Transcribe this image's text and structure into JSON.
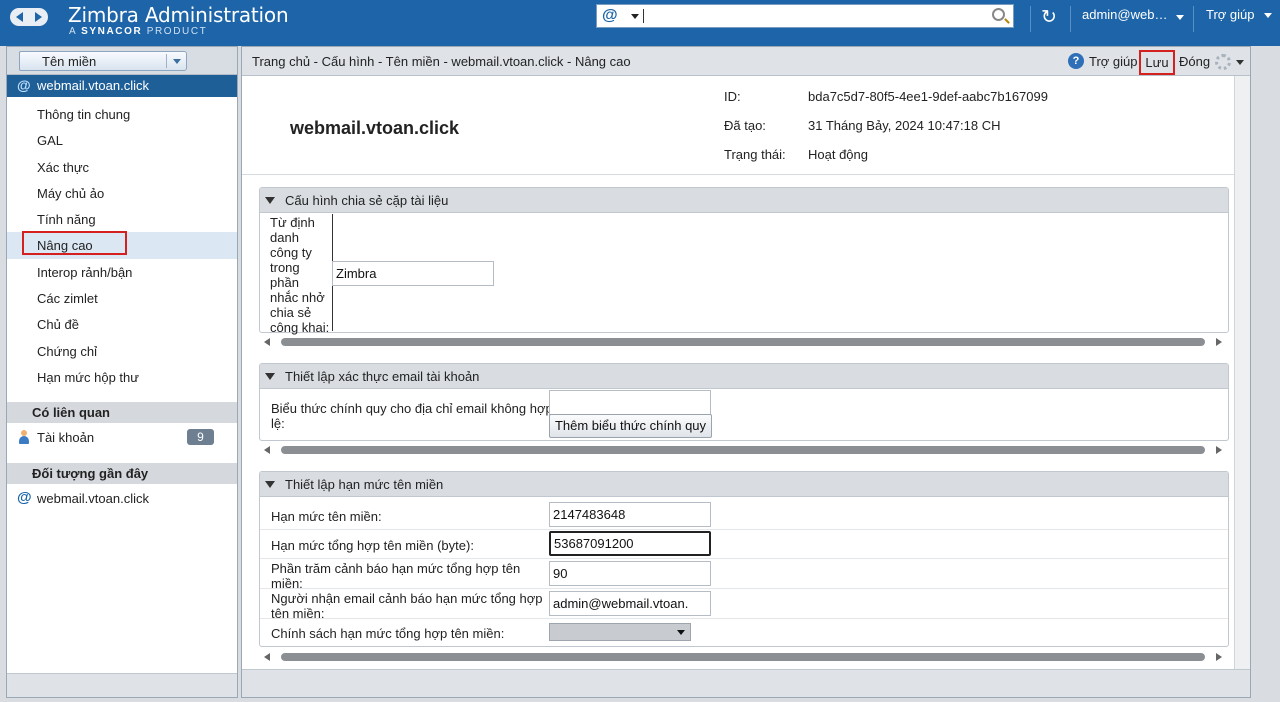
{
  "app": {
    "title": "Zimbra Administration",
    "subtitle_prefix": "A",
    "subtitle_brand": "SYNACOR",
    "subtitle_suffix": "PRODUCT",
    "search_icon": "@",
    "user": "admin@web…",
    "help": "Trợ giúp"
  },
  "sidebar": {
    "domain_button": "Tên miền",
    "selected_domain": "webmail.vtoan.click",
    "items": [
      {
        "label": "Thông tin chung"
      },
      {
        "label": "GAL"
      },
      {
        "label": "Xác thực"
      },
      {
        "label": "Máy chủ ảo"
      },
      {
        "label": "Tính năng"
      },
      {
        "label": "Nâng cao"
      },
      {
        "label": "Interop rảnh/bận"
      },
      {
        "label": "Các zimlet"
      },
      {
        "label": "Chủ đề"
      },
      {
        "label": "Chứng chỉ"
      },
      {
        "label": "Hạn mức hộp thư"
      }
    ],
    "active_index": 5,
    "related_title": "Có liên quan",
    "related_item": "Tài khoản",
    "related_count": "9",
    "recent_title": "Đối tượng gần đây",
    "recent_item": "webmail.vtoan.click"
  },
  "main": {
    "breadcrumb": "Trang chủ - Cấu hình - Tên miền - webmail.vtoan.click - Nâng cao",
    "help": "Trợ giúp",
    "save": "Lưu",
    "close": "Đóng",
    "domain_title": "webmail.vtoan.click",
    "info": {
      "id_label": "ID:",
      "id_value": "bda7c5d7-80f5-4ee1-9def-aabc7b167099",
      "created_label": "Đã tạo:",
      "created_value": "31 Tháng Bảy, 2024 10:47:18 CH",
      "status_label": "Trạng thái:",
      "status_value": "Hoạt động"
    },
    "sections": {
      "sharing": {
        "title": "Cấu hình chia sẻ cặp tài liệu",
        "field_label_lines": [
          "Từ định",
          "danh",
          "công ty",
          "trong",
          "phần",
          "nhắc nhở",
          "chia sẻ",
          "công khai:"
        ],
        "field_value": "Zimbra"
      },
      "email_validation": {
        "title": "Thiết lập xác thực email tài khoản",
        "field_label_line1": "Biểu thức chính quy cho địa chỉ email không hợp",
        "field_label_line2": "lệ:",
        "field_value": "",
        "add_button": "Thêm biểu thức chính quy"
      },
      "quota": {
        "title": "Thiết lập hạn mức tên miền",
        "quota_label": "Hạn mức tên miền:",
        "quota_value": "2147483648",
        "total_label": "Hạn mức tổng hợp tên miền (byte):",
        "total_value": "53687091200",
        "warn_pct_line1": "Phần trăm cảnh báo hạn mức tổng hợp tên",
        "warn_pct_line2": "miền:",
        "warn_pct_value": "90",
        "recipient_line1": "Người nhận email cảnh báo hạn mức tổng hợp",
        "recipient_line2": "tên miền:",
        "recipient_value": "admin@webmail.vtoan.",
        "policy_label": "Chính sách hạn mức tổng hợp tên miền:",
        "policy_value": ""
      }
    }
  }
}
